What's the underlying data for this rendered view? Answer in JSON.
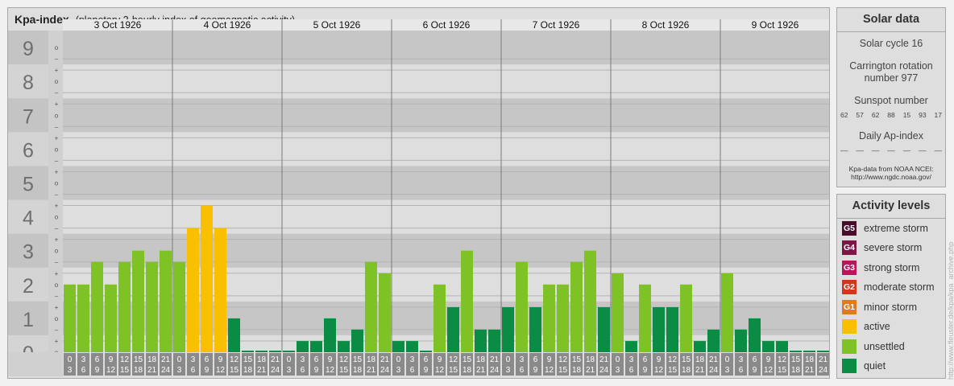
{
  "header": {
    "title": "Kpa-index",
    "subtitle": "(planetary 3-hourly index of geomagnetic activity)"
  },
  "chart_data": {
    "type": "bar",
    "title": "Kpa-index",
    "subtitle": "(planetary 3-hourly index of geomagnetic activity)",
    "ylim": [
      0,
      9
    ],
    "y_tick_labels": [
      "0",
      "1",
      "2",
      "3",
      "4",
      "5",
      "6",
      "7",
      "8",
      "9"
    ],
    "minor_tick_labels": [
      "o",
      "+",
      "–"
    ],
    "days": [
      "3 Oct 1926",
      "4 Oct 1926",
      "5 Oct 1926",
      "6 Oct 1926",
      "7 Oct 1926",
      "8 Oct 1926",
      "9 Oct 1926"
    ],
    "intervals": [
      {
        "start": "0",
        "end": "3"
      },
      {
        "start": "3",
        "end": "6"
      },
      {
        "start": "6",
        "end": "9"
      },
      {
        "start": "9",
        "end": "12"
      },
      {
        "start": "12",
        "end": "15"
      },
      {
        "start": "15",
        "end": "18"
      },
      {
        "start": "18",
        "end": "21"
      },
      {
        "start": "21",
        "end": "24"
      }
    ],
    "values": [
      [
        2.0,
        2.0,
        2.67,
        2.0,
        2.67,
        3.0,
        2.67,
        3.0
      ],
      [
        2.67,
        3.67,
        4.33,
        3.67,
        1.0,
        0.0,
        0.0,
        0.0
      ],
      [
        0.0,
        0.33,
        0.33,
        1.0,
        0.33,
        0.67,
        2.67,
        2.33
      ],
      [
        0.33,
        0.33,
        0.0,
        2.0,
        1.33,
        3.0,
        0.67,
        0.67
      ],
      [
        1.33,
        2.67,
        1.33,
        2.0,
        2.0,
        2.67,
        3.0,
        1.33
      ],
      [
        2.33,
        0.33,
        2.0,
        1.33,
        1.33,
        2.0,
        0.33,
        0.67
      ],
      [
        2.33,
        0.67,
        1.0,
        0.33,
        0.33,
        0.0,
        0.0,
        0.0
      ]
    ],
    "levels": [
      [
        1,
        1,
        1,
        1,
        1,
        1,
        1,
        1
      ],
      [
        1,
        2,
        2,
        2,
        0,
        0,
        0,
        0
      ],
      [
        0,
        0,
        0,
        0,
        0,
        0,
        1,
        1
      ],
      [
        0,
        0,
        0,
        1,
        0,
        1,
        0,
        0
      ],
      [
        0,
        1,
        0,
        1,
        1,
        1,
        1,
        0
      ],
      [
        1,
        0,
        1,
        0,
        0,
        1,
        0,
        0
      ],
      [
        1,
        0,
        0,
        0,
        0,
        0,
        0,
        0
      ]
    ],
    "colors": {
      "quiet": "#0a8c45",
      "unsettled": "#7fc225",
      "active": "#f8c000",
      "minor_storm": "#e07b1d",
      "moderate_storm": "#d0371c",
      "strong_storm": "#b8165c",
      "severe_storm": "#7d1547",
      "extreme_storm": "#4a0a2a",
      "band_dark": "#c6c6c6",
      "band_light": "#dedede",
      "time_label_bg": "#8a8a8a"
    }
  },
  "solar_data": {
    "heading": "Solar data",
    "cycle": "Solar cycle 16",
    "carrington_label": "Carrington rotation",
    "carrington_number": "number 977",
    "sunspot_label": "Sunspot number",
    "sunspot_values": [
      "62",
      "57",
      "62",
      "88",
      "15",
      "93",
      "17"
    ],
    "ap_label": "Daily Ap-index",
    "ap_values": [
      "––",
      "––",
      "––",
      "––",
      "––",
      "––",
      "––"
    ],
    "source_line1": "Kpa-data from NOAA NCEI:",
    "source_line2": "http://www.ngdc.noaa.gov/"
  },
  "activity_levels": {
    "heading": "Activity levels",
    "items": [
      {
        "code": "G5",
        "label": "extreme storm",
        "color": "#4a0a2a"
      },
      {
        "code": "G4",
        "label": "severe storm",
        "color": "#7d1547"
      },
      {
        "code": "G3",
        "label": "strong storm",
        "color": "#b8165c"
      },
      {
        "code": "G2",
        "label": "moderate storm",
        "color": "#d0371c"
      },
      {
        "code": "G1",
        "label": "minor storm",
        "color": "#e07b1d"
      },
      {
        "code": "",
        "label": "active",
        "color": "#f8c000"
      },
      {
        "code": "",
        "label": "unsettled",
        "color": "#7fc225"
      },
      {
        "code": "",
        "label": "quiet",
        "color": "#0a8c45"
      }
    ]
  },
  "watermark": "http://www.fleuster.de/kpa/kpa_archive.php"
}
